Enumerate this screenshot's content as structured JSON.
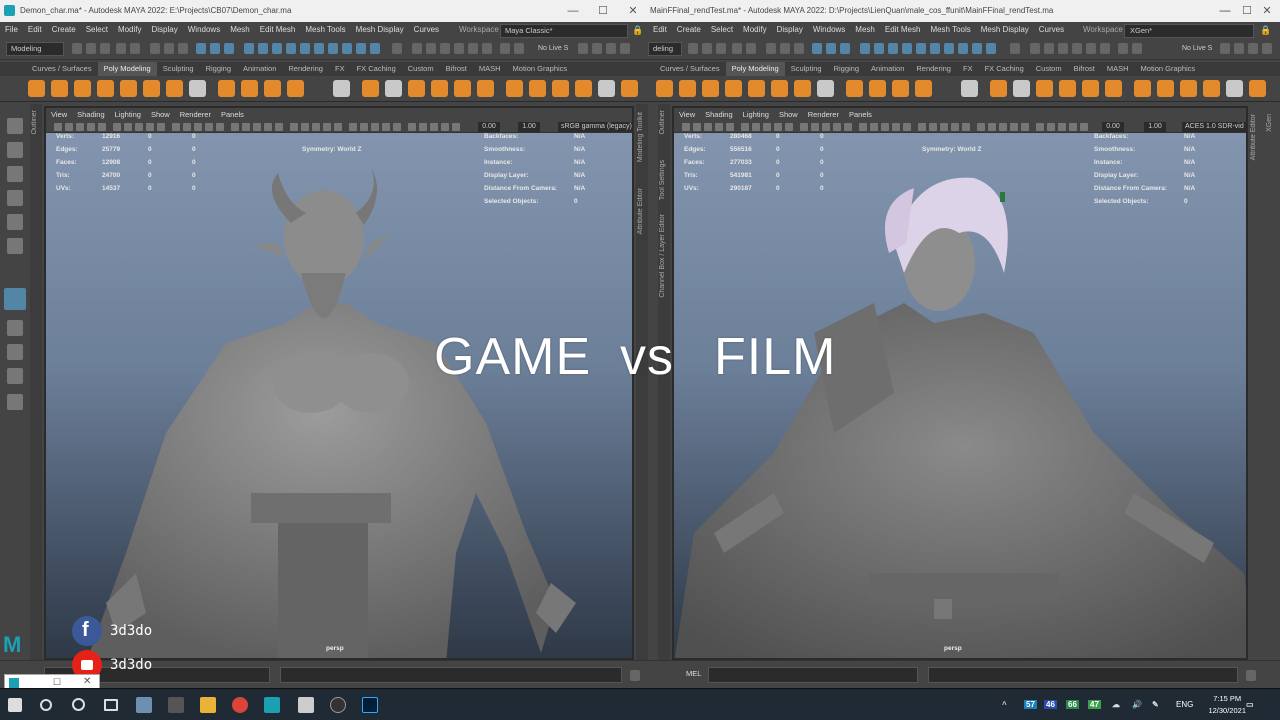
{
  "left_window": {
    "title": "Demon_char.ma* - Autodesk MAYA 2022: E:\\Projects\\CB07\\Demon_char.ma",
    "menus": [
      "File",
      "Edit",
      "Create",
      "Select",
      "Modify",
      "Display",
      "Windows",
      "Mesh",
      "Edit Mesh",
      "Mesh Tools",
      "Mesh Display",
      "Curves"
    ],
    "workspace_label": "Workspace :",
    "workspace_value": "Maya Classic*",
    "mode": "Modeling",
    "no_live": "No Live S",
    "shelf_tabs": [
      "Curves / Surfaces",
      "Poly Modeling",
      "Sculpting",
      "Rigging",
      "Animation",
      "Rendering",
      "FX",
      "FX Caching",
      "Custom",
      "Bifrost",
      "MASH",
      "Motion Graphics"
    ],
    "viewport_menus": [
      "View",
      "Shading",
      "Lighting",
      "Show",
      "Renderer",
      "Panels"
    ],
    "exposure": "0.00",
    "gamma": "1.00",
    "color_space": "sRGB gamma (legacy)",
    "hud_stats": [
      {
        "label": "Verts:",
        "v": "12916",
        "a": "0",
        "b": "0"
      },
      {
        "label": "Edges:",
        "v": "25779",
        "a": "0",
        "b": "0"
      },
      {
        "label": "Faces:",
        "v": "12908",
        "a": "0",
        "b": "0"
      },
      {
        "label": "Tris:",
        "v": "24700",
        "a": "0",
        "b": "0"
      },
      {
        "label": "UVs:",
        "v": "14537",
        "a": "0",
        "b": "0"
      }
    ],
    "symmetry": "Symmetry: World Z",
    "hud_right": [
      {
        "label": "Backfaces:",
        "v": "N/A"
      },
      {
        "label": "Smoothness:",
        "v": "N/A"
      },
      {
        "label": "Instance:",
        "v": "N/A"
      },
      {
        "label": "Display Layer:",
        "v": "N/A"
      },
      {
        "label": "Distance From Camera:",
        "v": "N/A"
      },
      {
        "label": "Selected Objects:",
        "v": "0"
      }
    ],
    "camera": "persp",
    "side_labels": [
      "Outliner",
      "Modeling Toolkit",
      "Attribute Editor"
    ]
  },
  "right_window": {
    "title": "MainFFinal_rendTest.ma* - Autodesk MAYA 2022: D:\\Projects\\LienQuan\\male_cos_ffunit\\MainFFinal_rendTest.ma",
    "menus": [
      "Edit",
      "Create",
      "Select",
      "Modify",
      "Display",
      "Windows",
      "Mesh",
      "Edit Mesh",
      "Mesh Tools",
      "Mesh Display",
      "Curves"
    ],
    "workspace_label": "Workspace :",
    "workspace_value": "XGen*",
    "mode": "deling",
    "no_live": "No Live S",
    "shelf_tabs": [
      "Curves / Surfaces",
      "Poly Modeling",
      "Sculpting",
      "Rigging",
      "Animation",
      "Rendering",
      "FX",
      "FX Caching",
      "Custom",
      "Bifrost",
      "MASH",
      "Motion Graphics"
    ],
    "viewport_menus": [
      "View",
      "Shading",
      "Lighting",
      "Show",
      "Renderer",
      "Panels"
    ],
    "exposure": "0.00",
    "gamma": "1.00",
    "color_space": "ACES 1.0 SDR-vid",
    "hud_stats": [
      {
        "label": "Verts:",
        "v": "280468",
        "a": "0",
        "b": "0"
      },
      {
        "label": "Edges:",
        "v": "556516",
        "a": "0",
        "b": "0"
      },
      {
        "label": "Faces:",
        "v": "277033",
        "a": "0",
        "b": "0"
      },
      {
        "label": "Tris:",
        "v": "541981",
        "a": "0",
        "b": "0"
      },
      {
        "label": "UVs:",
        "v": "290187",
        "a": "0",
        "b": "0"
      }
    ],
    "symmetry": "Symmetry: World Z",
    "hud_right": [
      {
        "label": "Backfaces:",
        "v": "N/A"
      },
      {
        "label": "Smoothness:",
        "v": "N/A"
      },
      {
        "label": "Instance:",
        "v": "N/A"
      },
      {
        "label": "Display Layer:",
        "v": "N/A"
      },
      {
        "label": "Distance From Camera:",
        "v": "N/A"
      },
      {
        "label": "Selected Objects:",
        "v": "0"
      }
    ],
    "camera": "persp",
    "side_labels": [
      "Outliner",
      "Tool Settings",
      "Channel Box / Layer Editor"
    ],
    "right_side_label": "Attribute Editor",
    "far_right_label": "XGen",
    "cmd_label": "MEL"
  },
  "overlay": {
    "game": "GAME",
    "vs": "vs",
    "film": "FILM",
    "facebook_handle": "3d3do",
    "youtube_handle": "3d3do"
  },
  "window_controls": {
    "min": "—",
    "max": "☐",
    "close": "✕"
  },
  "taskbar": {
    "tray_numbers": [
      "57",
      "46",
      "66",
      "47"
    ],
    "lang": "ENG",
    "time": "7:15 PM",
    "date": "12/30/2021"
  },
  "colors": {
    "maya_orange": "#e38b2c",
    "maya_blue": "#5285a6",
    "maya_teal": "#1ba1b3"
  }
}
